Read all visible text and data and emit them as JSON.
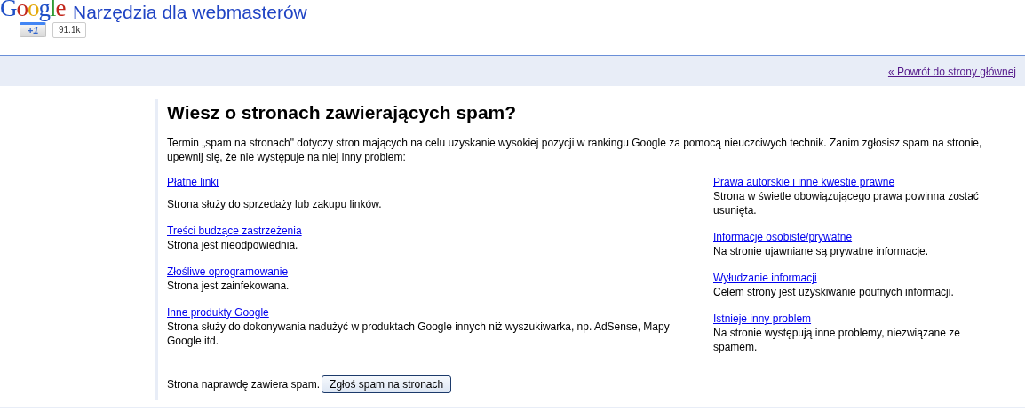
{
  "header": {
    "logo": "Google",
    "title": "Narzędzia dla webmasterów",
    "plus_one": {
      "label": "+1",
      "count": "91.1k"
    }
  },
  "nav": {
    "back_link": "« Powrót do strony głównej"
  },
  "content": {
    "heading": "Wiesz o stronach zawierających spam?",
    "intro": "Termin „spam na stronach\" dotyczy stron mających na celu uzyskanie wysokiej pozycji w rankingu Google za pomocą nieuczciwych technik. Zanim zgłosisz spam na stronie, upewnij się, że nie występuje na niej inny problem:",
    "columns": [
      [
        {
          "link": "Płatne linki",
          "description": "Strona służy do sprzedaży lub zakupu linków."
        },
        {
          "link": "Treści budzące zastrzeżenia",
          "description": "Strona jest nieodpowiednia."
        },
        {
          "link": "Złośliwe oprogramowanie",
          "description": "Strona jest zainfekowana."
        },
        {
          "link": "Inne produkty Google",
          "description": "Strona służy do dokonywania nadużyć w produktach Google innych niż wyszukiwarka, np. AdSense, Mapy Google itd."
        }
      ],
      [
        {
          "link": "Prawa autorskie i inne kwestie prawne",
          "description": "Strona w świetle obowiązującego prawa powinna zostać usunięta."
        },
        {
          "link": "Informacje osobiste/prywatne",
          "description": "Na stronie ujawniane są prywatne informacje."
        },
        {
          "link": "Wyłudzanie informacji",
          "description": "Celem strony jest uzyskiwanie poufnych informacji."
        },
        {
          "link": "Istnieje inny problem",
          "description": "Na stronie występują inne problemy, niezwiązane ze spamem."
        }
      ]
    ],
    "confirm_text": "Strona naprawdę zawiera spam.",
    "report_button": "Zgłoś spam na stronach"
  }
}
